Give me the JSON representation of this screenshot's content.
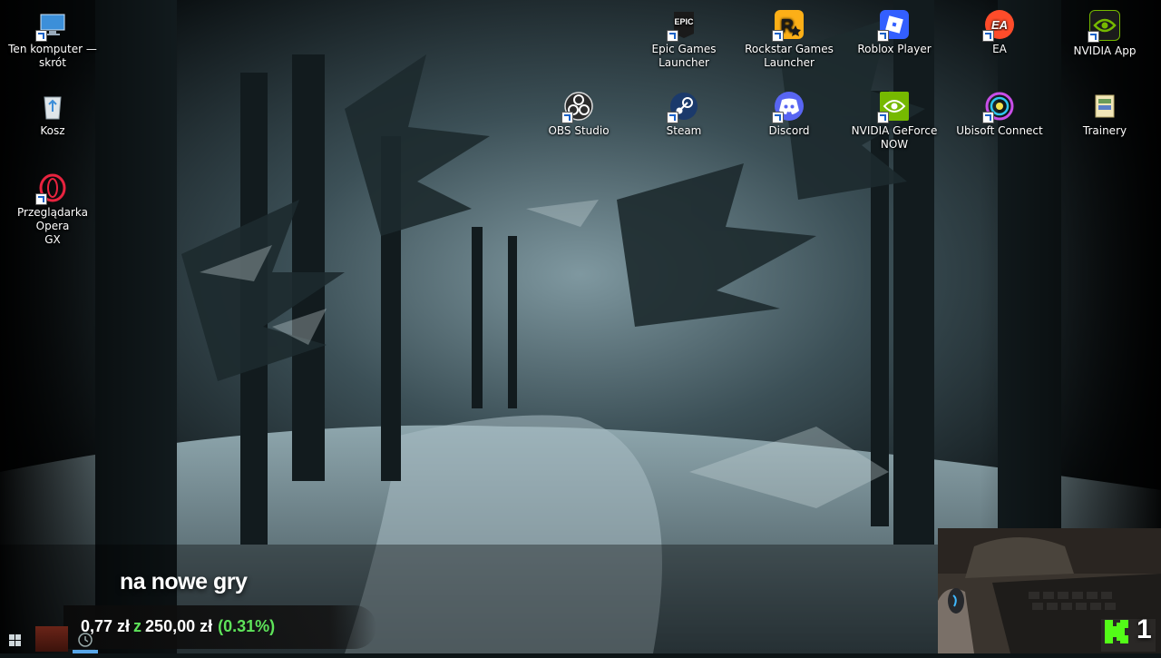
{
  "desktop": {
    "icons": [
      {
        "label": "Ten komputer —\nskrót",
        "icon": "computer-icon"
      },
      {
        "label": "Kosz",
        "icon": "recycle-bin-icon"
      },
      {
        "label": "Przeglądarka Opera\nGX",
        "icon": "opera-gx-icon"
      },
      {
        "label": "OBS Studio",
        "icon": "obs-icon"
      },
      {
        "label": "Epic Games\nLauncher",
        "icon": "epic-games-icon"
      },
      {
        "label": "Steam",
        "icon": "steam-icon"
      },
      {
        "label": "Rockstar Games\nLauncher",
        "icon": "rockstar-icon"
      },
      {
        "label": "Discord",
        "icon": "discord-icon"
      },
      {
        "label": "Roblox Player",
        "icon": "roblox-icon"
      },
      {
        "label": "NVIDIA GeForce\nNOW",
        "icon": "geforce-now-icon"
      },
      {
        "label": "EA",
        "icon": "ea-icon"
      },
      {
        "label": "Ubisoft Connect",
        "icon": "ubisoft-icon"
      },
      {
        "label": "NVIDIA App",
        "icon": "nvidia-app-icon"
      },
      {
        "label": "Trainery",
        "icon": "folder-icon"
      }
    ]
  },
  "stream_overlay": {
    "banner": "na nowe gry",
    "donation": {
      "current": "0,77 zł",
      "separator": "z",
      "goal": "250,00 zł",
      "percent": "(0.31%)",
      "progress_fraction": 0.0031
    },
    "cam_counter": "1",
    "cam_logo": "K"
  },
  "taskbar": {
    "start": "windows-logo-icon",
    "apps": [
      "game-app-icon",
      "clock-app-icon"
    ]
  },
  "colors": {
    "overlay_green": "#5ee35a",
    "kick_green": "#53fc18",
    "taskbar_accent": "#57a6e8"
  }
}
